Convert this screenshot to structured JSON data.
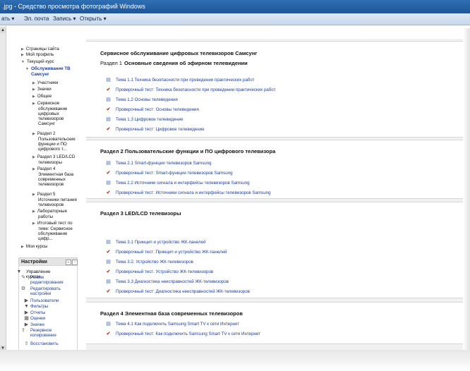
{
  "window": {
    "title": ".jpg - Средство просмотра фотографий Windows",
    "toolbar": [
      {
        "label": "ать ▾",
        "name": "print-menu"
      },
      {
        "label": "Эл. почта",
        "name": "email-button"
      },
      {
        "label": "Запись ▾",
        "name": "burn-menu"
      },
      {
        "label": "Открыть ▾",
        "name": "open-menu"
      }
    ]
  },
  "sidebar": {
    "nav_items": [
      {
        "label": "Страницы сайта",
        "tri": "▶"
      },
      {
        "label": "Мой профиль",
        "tri": "▶"
      },
      {
        "label": "Текущий курс",
        "tri": "▼"
      },
      {
        "label": "Обслуживание ТВ Самсунг",
        "tri": "▼",
        "active": true
      },
      {
        "label": "Участники",
        "tri": "▶"
      },
      {
        "label": "Значки",
        "tri": "▶"
      },
      {
        "label": "Общее",
        "tri": "▶"
      },
      {
        "label": "Сервисное обслуживание цифровых телевизоров Самсунг",
        "tri": "▶"
      },
      {
        "label": "Раздел 2 Пользовательские функции и ПО цифрового т...",
        "tri": "▶"
      },
      {
        "label": "Раздел 3 LED/LCD телевизоры",
        "tri": "▶"
      },
      {
        "label": "Раздел 4 Элементная база современных телевизоров",
        "tri": "▶"
      },
      {
        "label": "Раздел 5 Источники питания телевизоров",
        "tri": "▶"
      },
      {
        "label": "Лабораторные работы",
        "tri": "▶"
      },
      {
        "label": "Итоговый тест по теме: Сервисное обслуживание цифр...",
        "tri": "▶"
      },
      {
        "label": "Мои курсы",
        "tri": "▶"
      }
    ],
    "settings": {
      "title": "Настройки",
      "items": [
        {
          "label": "Управление курсом",
          "icon": "▼"
        },
        {
          "label": "Режим редактирования",
          "icon": "✎"
        },
        {
          "label": "Редактировать настройки",
          "icon": "⚙"
        },
        {
          "label": "Пользователи",
          "icon": "▶"
        },
        {
          "label": "Фильтры",
          "icon": "▼"
        },
        {
          "label": "Отчеты",
          "icon": "▶"
        },
        {
          "label": "Оценки",
          "icon": "▦"
        },
        {
          "label": "Значки",
          "icon": "▶"
        },
        {
          "label": "Резервное копирование",
          "icon": "⇪"
        },
        {
          "label": "Восстановить",
          "icon": "⇪"
        }
      ]
    }
  },
  "main": {
    "sections": [
      {
        "title": "Сервисное обслуживание цифровых телевизоров Самсунг",
        "subtitle_prefix": "Раздел 1",
        "subtitle": "Основные сведения об эфирном телевидении",
        "activities": [
          {
            "type": "page",
            "label": "Тема 1.1 Техника безопасности при проведении практических работ"
          },
          {
            "type": "quiz",
            "label": "Проверочный тест: Техника безопасности при проведении практических работ"
          },
          {
            "type": "page",
            "label": "Тема 1.2 Основы телевидения"
          },
          {
            "type": "quiz",
            "label": "Проверочный тест: Основы телевидения"
          },
          {
            "type": "page",
            "label": "Тема 1.3 Цифровое телевидение"
          },
          {
            "type": "quiz",
            "label": "Проверочный тест: Цифровое телевидение"
          }
        ]
      },
      {
        "title": "Раздел 2 Пользовательские функции и ПО цифрового телевизора",
        "activities": [
          {
            "type": "page",
            "label": "Тема 2.1 Smart-функции телевизоров Samsung"
          },
          {
            "type": "quiz",
            "label": "Проверочный тест: Smart-функции телевизоров Samsung"
          },
          {
            "type": "page",
            "label": "Тема 2.2 Источники сигнала и интерфейсы телевизоров Samsung"
          },
          {
            "type": "quiz",
            "label": "Проверочный тест: Источники сигнала и интерфейсы телевизоров Samsung"
          }
        ]
      },
      {
        "title": "Раздел 3 LED/LCD телевизоры",
        "activities": [
          {
            "type": "page",
            "label": "Тема 3.1 Принцип и устройство ЖК-панелей"
          },
          {
            "type": "quiz",
            "label": "Проверочный тест: Принцип и устройство ЖК-панелей"
          },
          {
            "type": "page",
            "label": "Тема 3.2. Устройство ЖК-телевизоров"
          },
          {
            "type": "quiz",
            "label": "Проверочный тест: Устройство ЖК-телевизоров"
          },
          {
            "type": "page",
            "label": "Тема 3.3 Диагностика неисправностей ЖК-телевизоров"
          },
          {
            "type": "quiz",
            "label": "Проверочный тест: Диагностика неисправностей ЖК-телевизоров"
          }
        ]
      },
      {
        "title": "Раздел 4 Элементная база современных телевизоров",
        "activities": [
          {
            "type": "page",
            "label": "Тема 4.1 Как подключить Samsung Smart TV к сети Интернет"
          },
          {
            "type": "quiz",
            "label": "Проверочный тест: Как подключить Samsung Smart TV к сети Интернет"
          }
        ]
      }
    ]
  }
}
